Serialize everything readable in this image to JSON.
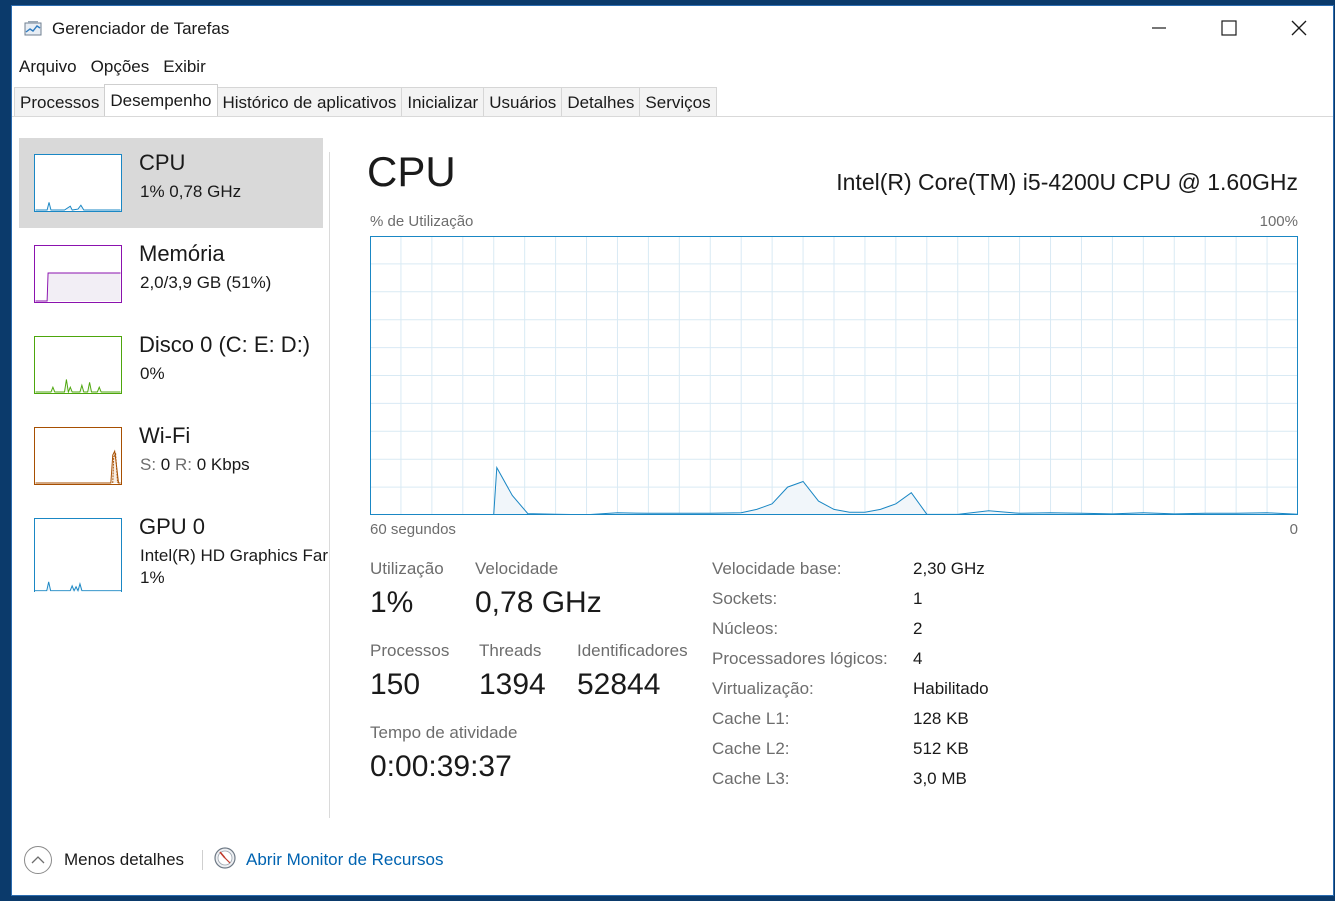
{
  "window": {
    "title": "Gerenciador de Tarefas"
  },
  "menu": [
    "Arquivo",
    "Opções",
    "Exibir"
  ],
  "tabs": [
    "Processos",
    "Desempenho",
    "Histórico de aplicativos",
    "Inicializar",
    "Usuários",
    "Detalhes",
    "Serviços"
  ],
  "active_tab": "Desempenho",
  "sidebar": {
    "items": [
      {
        "title": "CPU",
        "sub": "1%  0,78 GHz"
      },
      {
        "title": "Memória",
        "sub": "2,0/3,9 GB (51%)"
      },
      {
        "title": "Disco 0 (C: E: D:)",
        "sub": "0%"
      },
      {
        "title": "Wi-Fi",
        "sub_s_label": "S:",
        "sub_s_value": "0",
        "sub_r_label": "R:",
        "sub_r_value": "0 Kbps"
      },
      {
        "title": "GPU 0",
        "sub": "Intel(R) HD Graphics Far",
        "sub2": "1%"
      }
    ]
  },
  "main": {
    "title": "CPU",
    "model": "Intel(R) Core(TM) i5-4200U CPU @ 1.60GHz",
    "graph": {
      "ylabel": "% de Utilização",
      "ymax_label": "100%",
      "xlabel_left": "60 segundos",
      "xlabel_right": "0"
    },
    "stats": {
      "utilization_label": "Utilização",
      "utilization_value": "1%",
      "speed_label": "Velocidade",
      "speed_value": "0,78 GHz",
      "processes_label": "Processos",
      "processes_value": "150",
      "threads_label": "Threads",
      "threads_value": "1394",
      "handles_label": "Identificadores",
      "handles_value": "52844",
      "uptime_label": "Tempo de atividade",
      "uptime_value": "0:00:39:37"
    },
    "specs": [
      {
        "label": "Velocidade base:",
        "value": "2,30 GHz"
      },
      {
        "label": "Sockets:",
        "value": "1"
      },
      {
        "label": "Núcleos:",
        "value": "2"
      },
      {
        "label": "Processadores lógicos:",
        "value": "4"
      },
      {
        "label": "Virtualização:",
        "value": "Habilitado"
      },
      {
        "label": "Cache L1:",
        "value": "128 KB"
      },
      {
        "label": "Cache L2:",
        "value": "512 KB"
      },
      {
        "label": "Cache L3:",
        "value": "3,0 MB"
      }
    ]
  },
  "footer": {
    "less_details": "Menos detalhes",
    "resource_monitor": "Abrir Monitor de Recursos"
  },
  "colors": {
    "cpu": "#1a87c4",
    "memory": "#8b12ae",
    "disk": "#4da60c",
    "wifi": "#a74f01",
    "gpu": "#1a87c4",
    "link": "#0063b1"
  },
  "chart_data": {
    "type": "area",
    "x": [
      60,
      58,
      56,
      54,
      52,
      51.8,
      50.8,
      49.8,
      48,
      46,
      44,
      42,
      40,
      38,
      36,
      35,
      34,
      33,
      32,
      31,
      30,
      29,
      28,
      27,
      26,
      25,
      24,
      22,
      20,
      18,
      16,
      14,
      12,
      10,
      8,
      6,
      4,
      2,
      0
    ],
    "values": [
      0,
      0,
      0,
      0,
      0,
      17,
      7,
      0.5,
      0.3,
      0.1,
      0.8,
      0.6,
      0.6,
      0.6,
      0.8,
      2,
      4,
      10,
      12,
      5,
      2,
      1,
      1,
      2,
      4,
      8,
      0.3,
      0.2,
      1.5,
      0.6,
      0.8,
      0.6,
      0.4,
      0.8,
      0.4,
      0.6,
      0.6,
      0.8,
      0.3
    ],
    "ylim": [
      0,
      100
    ],
    "xlim": [
      60,
      0
    ],
    "grid": true
  }
}
